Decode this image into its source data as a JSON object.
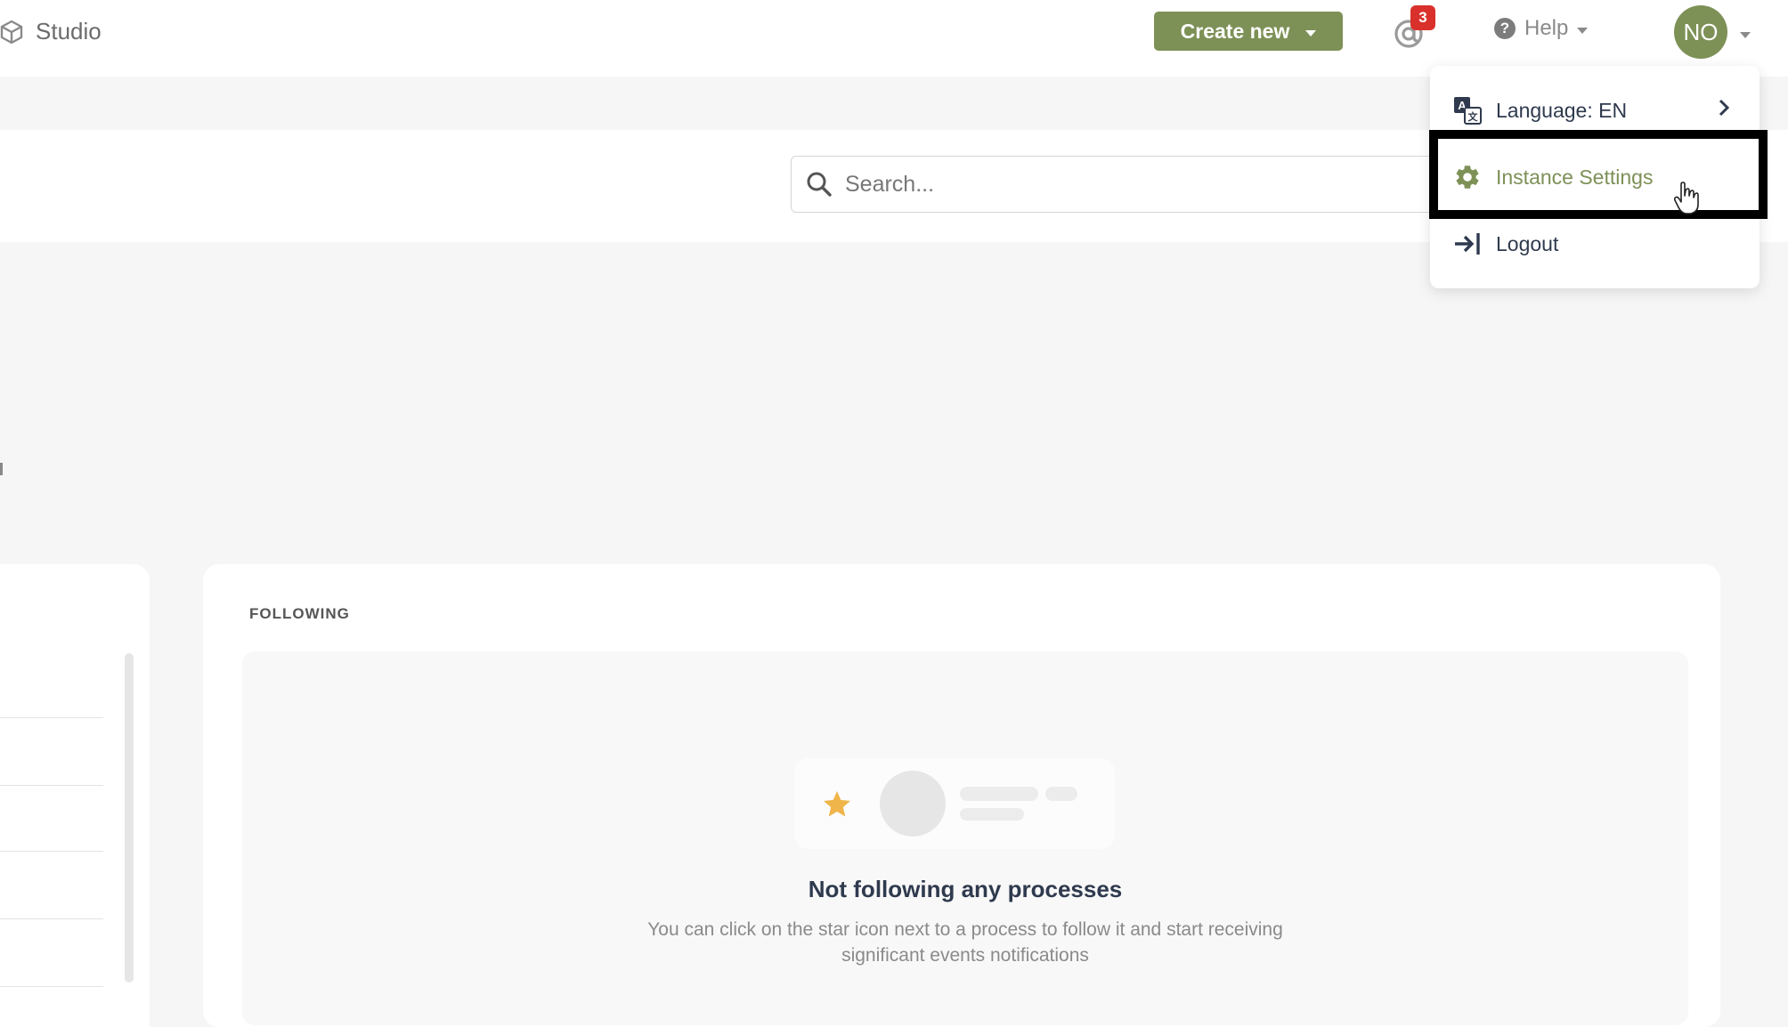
{
  "app": {
    "name": "Studio"
  },
  "header": {
    "create_label": "Create new",
    "notification_count": "3",
    "help_label": "Help",
    "avatar_initials": "NO"
  },
  "search": {
    "placeholder": "Search..."
  },
  "following": {
    "title": "FOLLOWING",
    "empty_title": "Not following any processes",
    "empty_desc": "You can click on the star icon next to a process to follow it and start receiving significant events notifications"
  },
  "user_menu": {
    "items": [
      {
        "label": "Language: EN",
        "icon": "translate-icon"
      },
      {
        "label": "Instance Settings",
        "icon": "gear-icon"
      },
      {
        "label": "Logout",
        "icon": "logout-icon"
      }
    ]
  },
  "colors": {
    "accent": "#7d9157",
    "badge": "#d9302b",
    "star": "#f0b54a",
    "text_dark": "#2f3a4e"
  }
}
